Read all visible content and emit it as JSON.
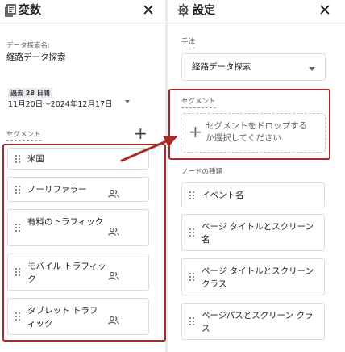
{
  "variables_panel": {
    "title": "変数",
    "icon": "variables-icon",
    "close_icon": "close-icon",
    "exploration_name_label": "データ探索名:",
    "exploration_name_value": "経路データ探索",
    "date_range_label": "過去 28 日間",
    "date_range_value": "11月20日～2024年12月17日",
    "segments_label": "セグメント",
    "segments": [
      {
        "label": "米国",
        "has_people_icon": false
      },
      {
        "label": "ノーリファラー",
        "has_people_icon": true
      },
      {
        "label": "有料のトラフィック",
        "has_people_icon": true
      },
      {
        "label": "モバイル トラフィック",
        "has_people_icon": true
      },
      {
        "label": "タブレット トラフィック",
        "has_people_icon": true
      }
    ]
  },
  "settings_panel": {
    "title": "設定",
    "icon": "gear-icon",
    "close_icon": "close-icon",
    "technique_label": "手法",
    "technique_value": "経路データ探索",
    "segment_label": "セグメント",
    "dropzone_text": "セグメントをドロップするか選択してください",
    "node_types_label": "ノードの種類",
    "node_types": [
      "イベント名",
      "ページ タイトルとスクリーン名",
      "ページ タイトルとスクリーン クラス",
      "ページパスとスクリーン クラス"
    ]
  },
  "colors": {
    "annotation_red": "#a52a2a",
    "divider": "#e8eaed",
    "chip_border": "#dadce0",
    "text": "#202124",
    "muted_text": "#5f6368"
  }
}
